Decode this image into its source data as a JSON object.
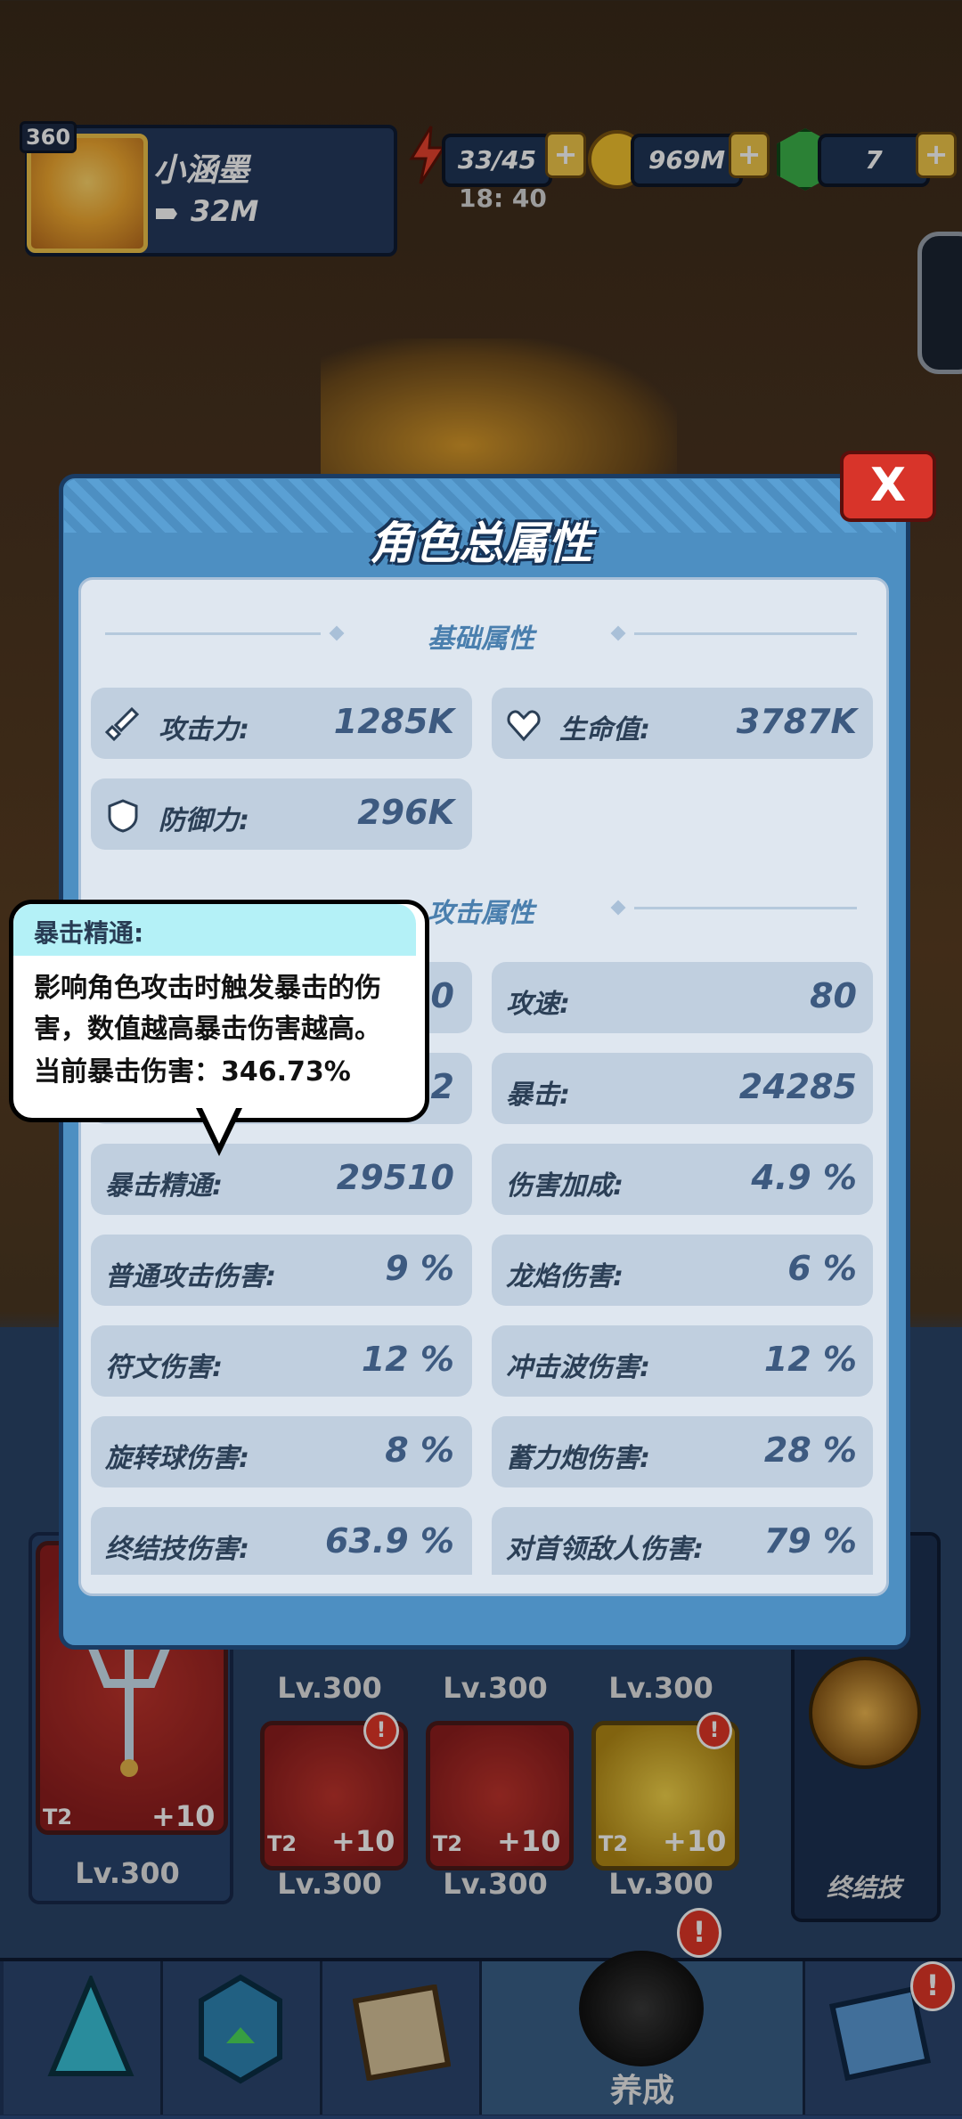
{
  "hud": {
    "level": "360",
    "player_name": "小涵墨",
    "power": "32M",
    "energy": "33/45",
    "energy_timer": "18: 40",
    "gold": "969M",
    "gems": "7",
    "plus_label": "+"
  },
  "modal": {
    "title": "角色总属性",
    "close_label": "X",
    "basic_section": "基础属性",
    "attack_section": "攻击属性",
    "basic": [
      {
        "label": "攻击力:",
        "value": "1285K",
        "icon": "sword-icon"
      },
      {
        "label": "生命值:",
        "value": "3787K",
        "icon": "heart-icon"
      },
      {
        "label": "防御力:",
        "value": "296K",
        "icon": "shield-icon"
      }
    ],
    "attack_left": [
      {
        "label": "",
        "value": "0"
      },
      {
        "label": "",
        "value": "92"
      },
      {
        "label": "暴击精通:",
        "value": "29510"
      },
      {
        "label": "普通攻击伤害:",
        "value": "9 %"
      },
      {
        "label": "符文伤害:",
        "value": "12 %"
      },
      {
        "label": "旋转球伤害:",
        "value": "8 %"
      },
      {
        "label": "终结技伤害:",
        "value": "63.9 %"
      }
    ],
    "attack_right": [
      {
        "label": "攻速:",
        "value": "80"
      },
      {
        "label": "暴击:",
        "value": "24285"
      },
      {
        "label": "伤害加成:",
        "value": "4.9 %"
      },
      {
        "label": "龙焰伤害:",
        "value": "6 %"
      },
      {
        "label": "冲击波伤害:",
        "value": "12 %"
      },
      {
        "label": "蓄力炮伤害:",
        "value": "28 %"
      },
      {
        "label": "对首领敌人伤害:",
        "value": "79 %"
      }
    ]
  },
  "tooltip": {
    "title": "暴击精通:",
    "line1": "影响角色攻击时触发暴击的伤",
    "line2": "害，数值越高暴击伤害越高。",
    "line3": "当前暴击伤害：346.73%"
  },
  "equipment": {
    "main_tier": "T2",
    "main_plus": "+10",
    "main_level": "Lv.300",
    "top_levels": [
      "Lv.300",
      "Lv.300",
      "Lv.300"
    ],
    "items": [
      {
        "tier": "T2",
        "plus": "+10",
        "level": "Lv.300"
      },
      {
        "tier": "T2",
        "plus": "+10",
        "level": "Lv.300"
      },
      {
        "tier": "T2",
        "plus": "+10",
        "level": "Lv.300"
      }
    ],
    "ultimate_label": "终结技"
  },
  "nav": {
    "active_label": "养成",
    "badge": "!"
  }
}
